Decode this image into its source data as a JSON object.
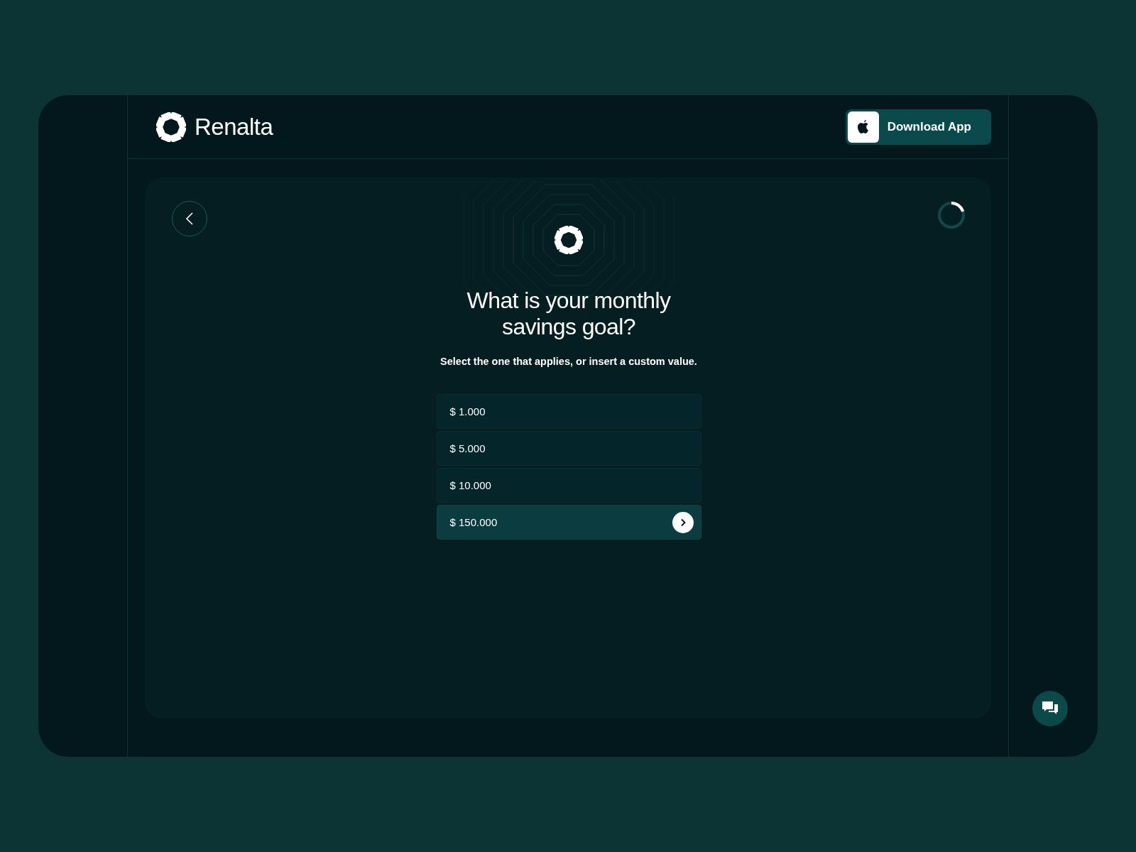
{
  "header": {
    "brand": "Renalta",
    "download_button": "Download App"
  },
  "progress": {
    "level": 0.2
  },
  "question": {
    "title": "What is your monthly savings goal?",
    "subtitle": "Select the one that applies, or insert a custom value."
  },
  "options": [
    {
      "label": "$ 1.000",
      "selected": false
    },
    {
      "label": "$ 5.000",
      "selected": false
    },
    {
      "label": "$ 10.000",
      "selected": false
    },
    {
      "label": "$ 150.000",
      "selected": true
    }
  ]
}
